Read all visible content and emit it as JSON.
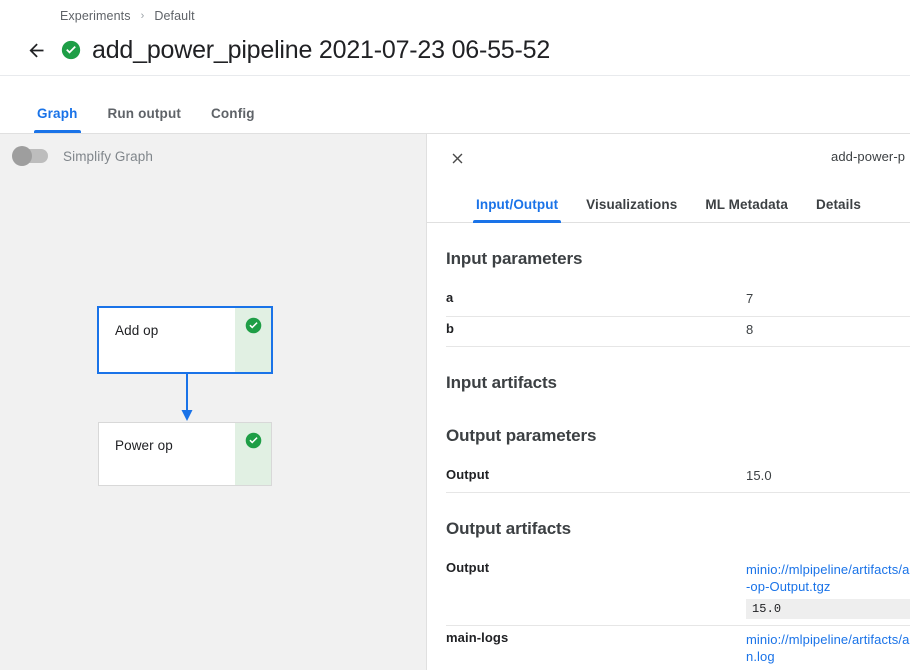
{
  "header": {
    "breadcrumb": [
      {
        "label": "Experiments"
      },
      {
        "label": "Default"
      }
    ],
    "breadcrumb_separator": "›",
    "back_icon": "arrow-left-icon",
    "status_icon": "check-circle-icon",
    "run_title": "add_power_pipeline 2021-07-23 06-55-52"
  },
  "main_tabs": [
    {
      "label": "Graph",
      "active": true
    },
    {
      "label": "Run output",
      "active": false
    },
    {
      "label": "Config",
      "active": false
    }
  ],
  "graph": {
    "simplify_toggle": {
      "label": "Simplify Graph",
      "checked": false
    },
    "nodes": [
      {
        "label": "Add op",
        "status": "succeeded",
        "selected": true
      },
      {
        "label": "Power op",
        "status": "succeeded",
        "selected": false
      }
    ],
    "edge_color": "#1a73e8"
  },
  "side_panel": {
    "close_icon": "close-icon",
    "node_title": "add-power-p",
    "tabs": [
      {
        "label": "Input/Output",
        "active": true
      },
      {
        "label": "Visualizations",
        "active": false
      },
      {
        "label": "ML Metadata",
        "active": false
      },
      {
        "label": "Details",
        "active": false
      }
    ],
    "sections": {
      "input_parameters": {
        "title": "Input parameters",
        "rows": [
          {
            "key": "a",
            "value": "7"
          },
          {
            "key": "b",
            "value": "8"
          }
        ]
      },
      "input_artifacts": {
        "title": "Input artifacts",
        "rows": []
      },
      "output_parameters": {
        "title": "Output parameters",
        "rows": [
          {
            "key": "Output",
            "value": "15.0"
          }
        ]
      },
      "output_artifacts": {
        "title": "Output artifacts",
        "rows": [
          {
            "key": "Output",
            "link": "minio://mlpipeline/artifacts/a-op-Output.tgz",
            "preview": "15.0"
          },
          {
            "key": "main-logs",
            "link": "minio://mlpipeline/artifacts/an.log",
            "preview": null
          }
        ]
      }
    }
  },
  "colors": {
    "accent": "#1a73e8",
    "success": "#1e9e46",
    "success_bg": "#e1f0e3",
    "canvas_bg": "#f1f1f1",
    "text_primary": "#202124",
    "text_secondary": "#5f6368"
  }
}
